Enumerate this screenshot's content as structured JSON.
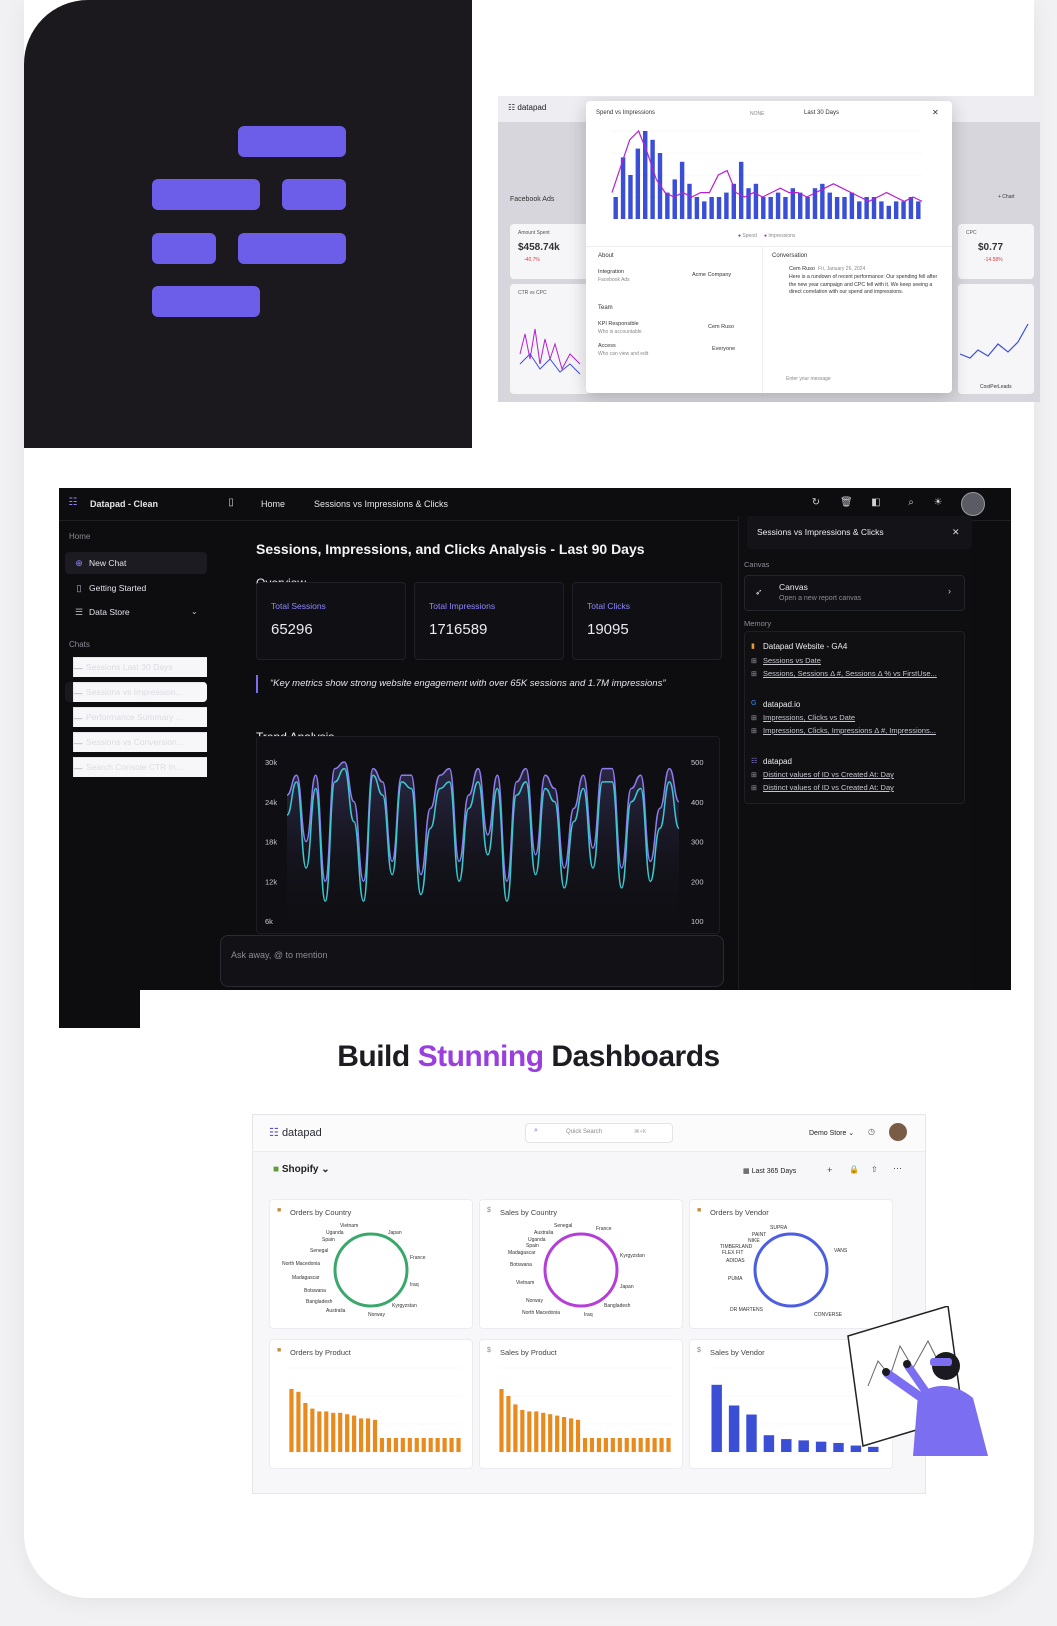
{
  "colors": {
    "brand_purple": "#6c5ee8",
    "accent_text": "#9b3ee0",
    "dark_bg": "#0d0d10",
    "chart_blue": "#3b4fd6",
    "chart_magenta": "#b61fd1",
    "cyan_line": "#3ac9d0",
    "violet_line": "#8d7cf0",
    "orange_bar": "#e88a1e"
  },
  "logo": {
    "icon": "datapad-logo-icon"
  },
  "preview_top": {
    "brand": "datapad",
    "modal": {
      "title": "Spend vs Impressions",
      "none_label": "NONE",
      "date_range": "Last 30 Days",
      "legend": [
        "Spend",
        "Impressions"
      ],
      "about_title": "About",
      "integration_label": "Integration",
      "integration_sub": "Facebook Ads",
      "integration_value": "Acme Company",
      "team_title": "Team",
      "kpi_label": "KPI Responsible",
      "kpi_sub": "Who is accountable",
      "kpi_value": "Cem Ruso",
      "access_label": "Access",
      "access_sub": "Who can view and edit",
      "access_value": "Everyone",
      "conversation_title": "Conversation",
      "conv_author": "Cem Ruso",
      "conv_time": "Fri, January 26, 2024",
      "conv_text": "Here is a rundown of recent performance: Our spending fell after the new year campaign and CPC fell with it. We keep seeing a direct correlation with our spend and impressions.",
      "message_placeholder": "Enter your message"
    },
    "behind": {
      "source": "Facebook Ads",
      "amount_label": "Amount Spent",
      "amount_value": "$458.74k",
      "amount_change": "-40.7%",
      "ctr_label": "CTR vs CPC",
      "cpc_label": "CPC",
      "cpc_value": "$0.77",
      "cpc_change": "-14.58%",
      "chart_btn": "+ Chart",
      "right_legend": "CostPerLeads"
    }
  },
  "app": {
    "workspace": "Datapad - Clean",
    "breadcrumb": [
      "Home",
      "Sessions vs Impressions & Clicks"
    ],
    "sidebar": {
      "section_home": "Home",
      "items": [
        {
          "label": "New Chat",
          "icon": "chat-plus-icon"
        },
        {
          "label": "Getting Started",
          "icon": "book-icon"
        },
        {
          "label": "Data Store",
          "icon": "database-icon"
        }
      ],
      "section_chats": "Chats",
      "chats": [
        "Sessions Last 30 Days",
        "Sessions vs Impression...",
        "Performance Summary ...",
        "Sessions vs Conversion...",
        "Search Console CTR In..."
      ]
    },
    "main": {
      "title": "Sessions, Impressions, and Clicks Analysis - Last 90 Days",
      "overview": "Overview",
      "metrics": [
        {
          "label": "Total Sessions",
          "value": "65296"
        },
        {
          "label": "Total Impressions",
          "value": "1716589"
        },
        {
          "label": "Total Clicks",
          "value": "19095"
        }
      ],
      "quote": "“Key metrics show strong website engagement with over 65K sessions and 1.7M impressions”",
      "trend_title": "Trend Analysis",
      "ask_placeholder": "Ask away, @ to mention"
    },
    "right_panel": {
      "title": "Sessions vs Impressions & Clicks",
      "canvas_section": "Canvas",
      "canvas_title": "Canvas",
      "canvas_sub": "Open a new report canvas",
      "memory_section": "Memory",
      "sources": [
        {
          "name": "Datapad Website - GA4",
          "links": [
            "Sessions vs Date",
            "Sessions, Sessions Δ #, Sessions Δ % vs FirstUse..."
          ]
        },
        {
          "name": "datapad.io",
          "links": [
            "Impressions, Clicks vs Date",
            "Impressions, Clicks, Impressions Δ #, Impressions..."
          ]
        },
        {
          "name": "datapad",
          "links": [
            "Distinct values of ID vs Created At: Day",
            "Distinct values of ID vs Created At: Day"
          ]
        }
      ]
    }
  },
  "headline": {
    "part1": "Build ",
    "accent": "Stunning",
    "part2": " Dashboards"
  },
  "dashboard": {
    "brand": "datapad",
    "search_placeholder": "Quick Search",
    "search_shortcut": "⌘+K",
    "store": "Demo Store",
    "source": "Shopify",
    "date_range": "Last 365 Days",
    "cards": [
      {
        "title": "Orders by Country",
        "labels": [
          "Vietnam",
          "Uganda",
          "Spain",
          "Senegal",
          "North Macedonia",
          "Madagascar",
          "Botswana",
          "Bangladesh",
          "Australia",
          "Norway",
          "Kyrgyzstan",
          "Iraq",
          "France",
          "Japan"
        ]
      },
      {
        "title": "Sales by Country",
        "labels": [
          "Senegal",
          "Australia",
          "Uganda",
          "Spain",
          "Madagascar",
          "Botswana",
          "Vietnam",
          "Norway",
          "North Macedonia",
          "Iraq",
          "Bangladesh",
          "Japan",
          "Kyrgyzstan",
          "France"
        ]
      },
      {
        "title": "Orders by Vendor",
        "labels": [
          "SUPRA",
          "PAINT",
          "NIKE",
          "TIMBERLAND",
          "FLEX FIT",
          "ADIDAS",
          "PUMA",
          "DR MARTENS",
          "CONVERSE",
          "VANS"
        ]
      },
      {
        "title": "Orders by Product"
      },
      {
        "title": "Sales by Product"
      },
      {
        "title": "Sales by Vendor"
      }
    ]
  },
  "chart_data": [
    {
      "type": "line",
      "title": "Trend Analysis",
      "y_left": {
        "ticks": [
          "30k",
          "24k",
          "18k",
          "12k",
          "6k"
        ],
        "range": [
          6000,
          30000
        ]
      },
      "y_right": {
        "ticks": [
          "500",
          "400",
          "300",
          "200",
          "100"
        ],
        "range": [
          100,
          500
        ]
      },
      "series": [
        {
          "color": "#3ac9d0",
          "values": [
            22000,
            27000,
            14000,
            26000,
            9000,
            27000,
            29000,
            21000,
            9000,
            28000,
            25000,
            13000,
            27000,
            26000,
            10000,
            20000,
            26000,
            27000,
            12000,
            23000,
            27000,
            16000,
            26000,
            9000,
            25000,
            27000,
            13000,
            26000,
            24000,
            11000,
            21000,
            26000,
            14000,
            27000,
            27000,
            11000,
            24000,
            26000,
            12000,
            20000,
            27000,
            20000
          ]
        },
        {
          "color": "#8d7cf0",
          "values": [
            25000,
            28000,
            18000,
            28000,
            12000,
            29000,
            30000,
            24000,
            12000,
            29000,
            27000,
            15000,
            28000,
            28000,
            13000,
            23000,
            28000,
            29000,
            15000,
            25000,
            29000,
            19000,
            28000,
            12000,
            27000,
            29000,
            16000,
            28000,
            26000,
            14000,
            23000,
            28000,
            17000,
            29000,
            29000,
            14000,
            26000,
            28000,
            15000,
            23000,
            29000,
            24000
          ]
        }
      ]
    },
    {
      "type": "bar",
      "title": "Spend vs Impressions",
      "series": [
        {
          "name": "Spend",
          "values": [
            5,
            14,
            10,
            16,
            20,
            18,
            15,
            6,
            9,
            13,
            8,
            5,
            4,
            5,
            5,
            6,
            8,
            13,
            7,
            8,
            5,
            5,
            6,
            5,
            7,
            6,
            5,
            7,
            8,
            6,
            5,
            5,
            6,
            4,
            5,
            5,
            4,
            3,
            4,
            4,
            5,
            4
          ]
        },
        {
          "name": "Impressions",
          "values": [
            6,
            12,
            18,
            20,
            15,
            9,
            6,
            5,
            6,
            5,
            6,
            6,
            10,
            11,
            6,
            5,
            6,
            5,
            6,
            7,
            6,
            6,
            5,
            6,
            7,
            8,
            7,
            6,
            5,
            4,
            5,
            6,
            5,
            4,
            5,
            4
          ]
        }
      ]
    },
    {
      "type": "bar",
      "title": "Orders by Product",
      "values": [
        4.5,
        4.3,
        3.5,
        3.1,
        2.9,
        2.9,
        2.8,
        2.8,
        2.7,
        2.6,
        2.4,
        2.4,
        2.3,
        1.0,
        1.0,
        1.0,
        1.0,
        1.0,
        1.0,
        1.0,
        1.0,
        1.0,
        1.0,
        1.0,
        1.0
      ]
    },
    {
      "type": "bar",
      "title": "Sales by Product",
      "values": [
        4.5,
        4.0,
        3.4,
        3.0,
        2.9,
        2.9,
        2.8,
        2.7,
        2.6,
        2.5,
        2.4,
        2.3,
        1.0,
        1.0,
        1.0,
        1.0,
        1.0,
        1.0,
        1.0,
        1.0,
        1.0,
        1.0,
        1.0,
        1.0,
        1.0
      ]
    },
    {
      "type": "bar",
      "title": "Sales by Vendor",
      "values": [
        5.2,
        3.6,
        2.9,
        1.3,
        1.0,
        0.9,
        0.8,
        0.7,
        0.5,
        0.4
      ]
    }
  ]
}
